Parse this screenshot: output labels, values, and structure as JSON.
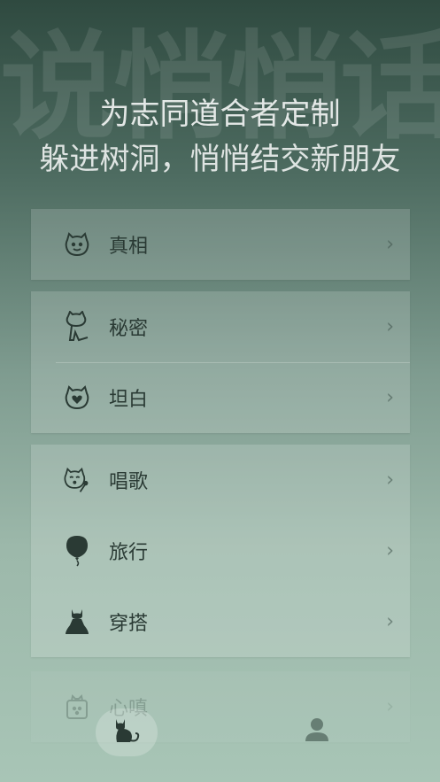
{
  "background_title": "说悄悄话",
  "tagline": {
    "line1": "为志同道合者定制",
    "line2": "躲进树洞，悄悄结交新朋友"
  },
  "groups": [
    {
      "items": [
        {
          "label": "真相",
          "icon": "smiling-cat-face-icon"
        }
      ]
    },
    {
      "items": [
        {
          "label": "秘密",
          "icon": "sitting-cat-icon"
        },
        {
          "label": "坦白",
          "icon": "cat-heart-icon"
        }
      ]
    },
    {
      "items": [
        {
          "label": "唱歌",
          "icon": "singing-cat-microphone-icon"
        },
        {
          "label": "旅行",
          "icon": "balloon-icon"
        },
        {
          "label": "穿搭",
          "icon": "cat-dress-icon"
        }
      ]
    },
    {
      "items": [
        {
          "label": "心嗔",
          "icon": "cat-box-icon"
        }
      ]
    }
  ],
  "chevron": "›",
  "tabbar": {
    "home_icon": "cat-tab-icon",
    "profile_icon": "person-icon"
  },
  "colors": {
    "icon": "#2a3a34",
    "text": "#2a3a34",
    "header_text": "#ffffff"
  }
}
